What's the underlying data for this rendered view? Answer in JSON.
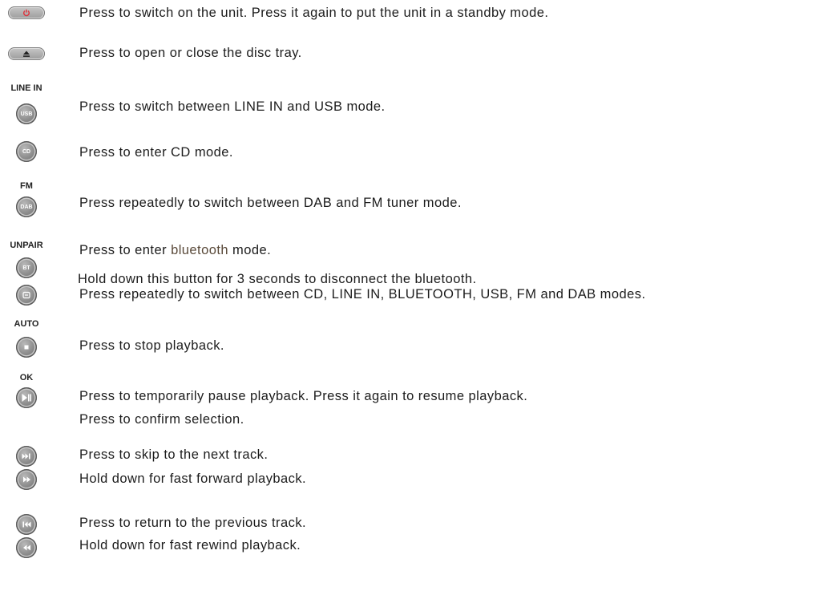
{
  "rows": {
    "power": {
      "text": "Press to switch on the unit. Press it again to put the unit in a standby mode.",
      "icon": "power-icon",
      "icon_color": "#e0303a"
    },
    "eject": {
      "text": "Press to open or close the disc tray.",
      "icon": "eject-icon"
    },
    "usb": {
      "label": "LINE IN",
      "button": "USB",
      "text": "Press to switch between LINE  IN and USB mode."
    },
    "cd": {
      "button": "CD",
      "text": "Press to enter CD mode."
    },
    "dab": {
      "label": "FM",
      "button": "DAB",
      "text": "Press repeatedly to switch between DAB and FM tuner mode."
    },
    "bt": {
      "label": "UNPAIR",
      "button": "BT",
      "text_prefix": "Press to enter ",
      "text_highlight": "bluetooth",
      "text_suffix": " mode.",
      "text2": "Hold down this button for 3 seconds to disconnect the bluetooth."
    },
    "source": {
      "icon": "source-icon",
      "text": "Press repeatedly to switch between CD, LINE IN, BLUETOOTH, USB, FM and DAB modes."
    },
    "stop": {
      "label": "AUTO",
      "icon": "stop-icon",
      "text": "Press to stop playback."
    },
    "play": {
      "label": "OK",
      "icon": "play-pause-icon",
      "text": "Press to temporarily pause playback. Press it again to resume playback.",
      "text2": "Press to confirm selection."
    },
    "next": {
      "icon": "next-track-icon",
      "text": "Press to skip to the next track."
    },
    "ff": {
      "icon": "fast-forward-icon",
      "text": "Hold down for fast forward playback."
    },
    "prev": {
      "icon": "previous-track-icon",
      "text": "Press to return to the previous track."
    },
    "rew": {
      "icon": "rewind-icon",
      "text": "Hold down for fast rewind playback."
    }
  }
}
